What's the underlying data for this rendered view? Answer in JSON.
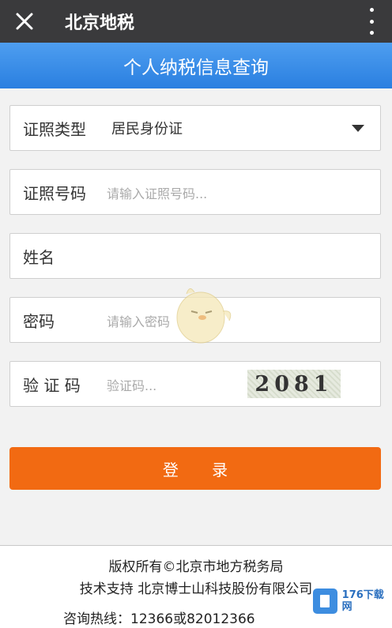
{
  "topbar": {
    "title": "北京地税"
  },
  "banner": {
    "title": "个人纳税信息查询"
  },
  "form": {
    "id_type": {
      "label": "证照类型",
      "value": "居民身份证"
    },
    "id_number": {
      "label": "证照号码",
      "placeholder": "请输入证照号码..."
    },
    "name": {
      "label": "姓名"
    },
    "password": {
      "label": "密码",
      "placeholder": "请输入密码"
    },
    "captcha": {
      "label": "验 证 码",
      "placeholder": "验证码...",
      "image_text": "2081"
    },
    "login_label": "登 录"
  },
  "footer": {
    "copyright": "版权所有©北京市地方税务局",
    "tech_support": "技术支持 北京博士山科技股份有限公司",
    "hotline": "咨询热线：12366或82012366"
  },
  "watermark": {
    "site": "176下载网"
  },
  "colors": {
    "topbar": "#3a3a3c",
    "banner": "#2a7fe0",
    "login": "#f26a12"
  }
}
